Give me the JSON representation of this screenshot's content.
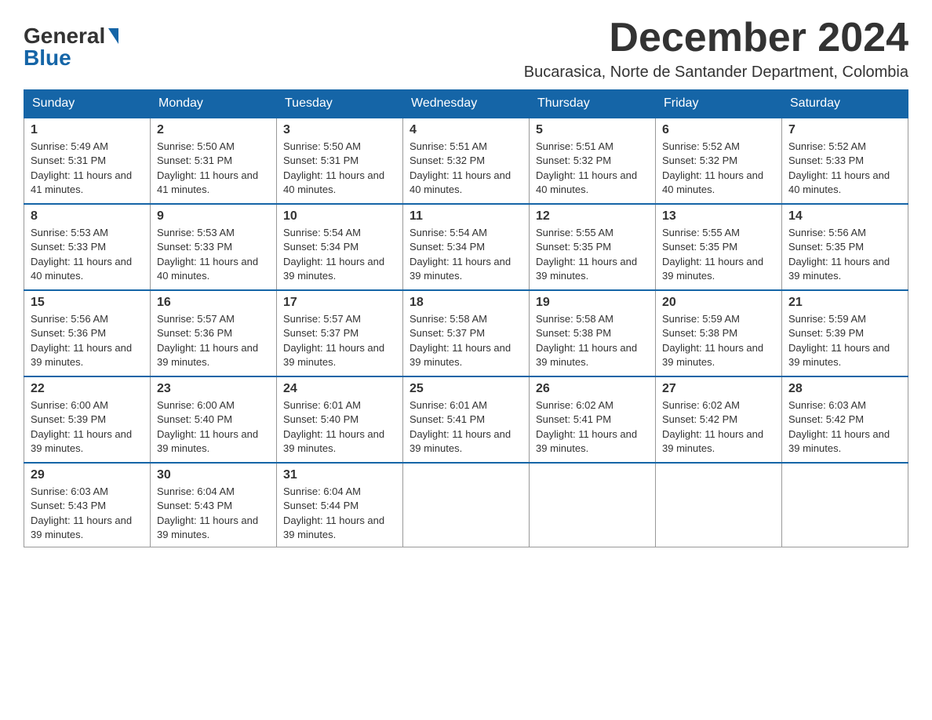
{
  "logo": {
    "general": "General",
    "blue": "Blue"
  },
  "title": "December 2024",
  "location": "Bucarasica, Norte de Santander Department, Colombia",
  "weekdays": [
    "Sunday",
    "Monday",
    "Tuesday",
    "Wednesday",
    "Thursday",
    "Friday",
    "Saturday"
  ],
  "weeks": [
    [
      {
        "day": "1",
        "sunrise": "5:49 AM",
        "sunset": "5:31 PM",
        "daylight": "11 hours and 41 minutes."
      },
      {
        "day": "2",
        "sunrise": "5:50 AM",
        "sunset": "5:31 PM",
        "daylight": "11 hours and 41 minutes."
      },
      {
        "day": "3",
        "sunrise": "5:50 AM",
        "sunset": "5:31 PM",
        "daylight": "11 hours and 40 minutes."
      },
      {
        "day": "4",
        "sunrise": "5:51 AM",
        "sunset": "5:32 PM",
        "daylight": "11 hours and 40 minutes."
      },
      {
        "day": "5",
        "sunrise": "5:51 AM",
        "sunset": "5:32 PM",
        "daylight": "11 hours and 40 minutes."
      },
      {
        "day": "6",
        "sunrise": "5:52 AM",
        "sunset": "5:32 PM",
        "daylight": "11 hours and 40 minutes."
      },
      {
        "day": "7",
        "sunrise": "5:52 AM",
        "sunset": "5:33 PM",
        "daylight": "11 hours and 40 minutes."
      }
    ],
    [
      {
        "day": "8",
        "sunrise": "5:53 AM",
        "sunset": "5:33 PM",
        "daylight": "11 hours and 40 minutes."
      },
      {
        "day": "9",
        "sunrise": "5:53 AM",
        "sunset": "5:33 PM",
        "daylight": "11 hours and 40 minutes."
      },
      {
        "day": "10",
        "sunrise": "5:54 AM",
        "sunset": "5:34 PM",
        "daylight": "11 hours and 39 minutes."
      },
      {
        "day": "11",
        "sunrise": "5:54 AM",
        "sunset": "5:34 PM",
        "daylight": "11 hours and 39 minutes."
      },
      {
        "day": "12",
        "sunrise": "5:55 AM",
        "sunset": "5:35 PM",
        "daylight": "11 hours and 39 minutes."
      },
      {
        "day": "13",
        "sunrise": "5:55 AM",
        "sunset": "5:35 PM",
        "daylight": "11 hours and 39 minutes."
      },
      {
        "day": "14",
        "sunrise": "5:56 AM",
        "sunset": "5:35 PM",
        "daylight": "11 hours and 39 minutes."
      }
    ],
    [
      {
        "day": "15",
        "sunrise": "5:56 AM",
        "sunset": "5:36 PM",
        "daylight": "11 hours and 39 minutes."
      },
      {
        "day": "16",
        "sunrise": "5:57 AM",
        "sunset": "5:36 PM",
        "daylight": "11 hours and 39 minutes."
      },
      {
        "day": "17",
        "sunrise": "5:57 AM",
        "sunset": "5:37 PM",
        "daylight": "11 hours and 39 minutes."
      },
      {
        "day": "18",
        "sunrise": "5:58 AM",
        "sunset": "5:37 PM",
        "daylight": "11 hours and 39 minutes."
      },
      {
        "day": "19",
        "sunrise": "5:58 AM",
        "sunset": "5:38 PM",
        "daylight": "11 hours and 39 minutes."
      },
      {
        "day": "20",
        "sunrise": "5:59 AM",
        "sunset": "5:38 PM",
        "daylight": "11 hours and 39 minutes."
      },
      {
        "day": "21",
        "sunrise": "5:59 AM",
        "sunset": "5:39 PM",
        "daylight": "11 hours and 39 minutes."
      }
    ],
    [
      {
        "day": "22",
        "sunrise": "6:00 AM",
        "sunset": "5:39 PM",
        "daylight": "11 hours and 39 minutes."
      },
      {
        "day": "23",
        "sunrise": "6:00 AM",
        "sunset": "5:40 PM",
        "daylight": "11 hours and 39 minutes."
      },
      {
        "day": "24",
        "sunrise": "6:01 AM",
        "sunset": "5:40 PM",
        "daylight": "11 hours and 39 minutes."
      },
      {
        "day": "25",
        "sunrise": "6:01 AM",
        "sunset": "5:41 PM",
        "daylight": "11 hours and 39 minutes."
      },
      {
        "day": "26",
        "sunrise": "6:02 AM",
        "sunset": "5:41 PM",
        "daylight": "11 hours and 39 minutes."
      },
      {
        "day": "27",
        "sunrise": "6:02 AM",
        "sunset": "5:42 PM",
        "daylight": "11 hours and 39 minutes."
      },
      {
        "day": "28",
        "sunrise": "6:03 AM",
        "sunset": "5:42 PM",
        "daylight": "11 hours and 39 minutes."
      }
    ],
    [
      {
        "day": "29",
        "sunrise": "6:03 AM",
        "sunset": "5:43 PM",
        "daylight": "11 hours and 39 minutes."
      },
      {
        "day": "30",
        "sunrise": "6:04 AM",
        "sunset": "5:43 PM",
        "daylight": "11 hours and 39 minutes."
      },
      {
        "day": "31",
        "sunrise": "6:04 AM",
        "sunset": "5:44 PM",
        "daylight": "11 hours and 39 minutes."
      },
      null,
      null,
      null,
      null
    ]
  ]
}
